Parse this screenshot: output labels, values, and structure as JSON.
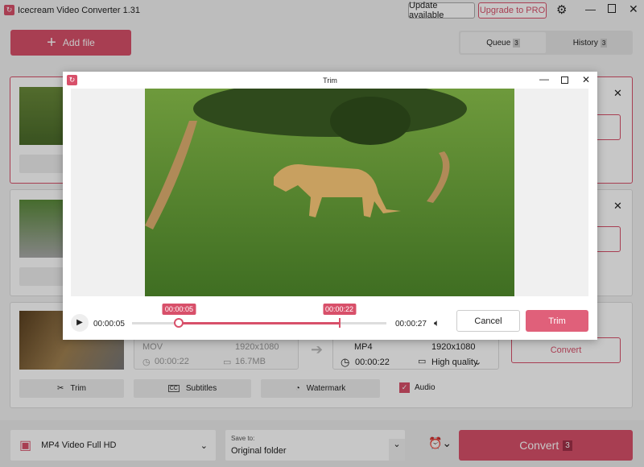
{
  "app": {
    "title": "Icecream Video Converter 1.31",
    "update": "Update available",
    "upgrade": "Upgrade to PRO"
  },
  "toolbar": {
    "add_file": "Add file",
    "tabs": [
      {
        "label": "Queue",
        "count": "3"
      },
      {
        "label": "History",
        "count": "3"
      }
    ]
  },
  "card3": {
    "input": {
      "format": "MOV",
      "resolution": "1920x1080",
      "duration": "00:00:22",
      "size": "16.7MB"
    },
    "output": {
      "format": "MP4",
      "resolution": "1920x1080",
      "duration": "00:00:22",
      "quality": "High quality"
    },
    "convert": "Convert",
    "tools": {
      "trim": "Trim",
      "subtitles": "Subtitles",
      "watermark": "Watermark",
      "audio": "Audio"
    },
    "audio_checked": true
  },
  "dialog": {
    "title": "Trim",
    "current_time": "00:00:05",
    "total_time": "00:00:27",
    "start_marker": "00:00:05",
    "end_marker": "00:00:22",
    "start_fraction": 0.185,
    "end_fraction": 0.815,
    "cancel": "Cancel",
    "trim": "Trim"
  },
  "bottom": {
    "preset": "MP4 Video Full HD",
    "save_label": "Save to:",
    "save_value": "Original folder",
    "convert": "Convert",
    "convert_count": "3"
  },
  "colors": {
    "accent": "#d8506a"
  }
}
